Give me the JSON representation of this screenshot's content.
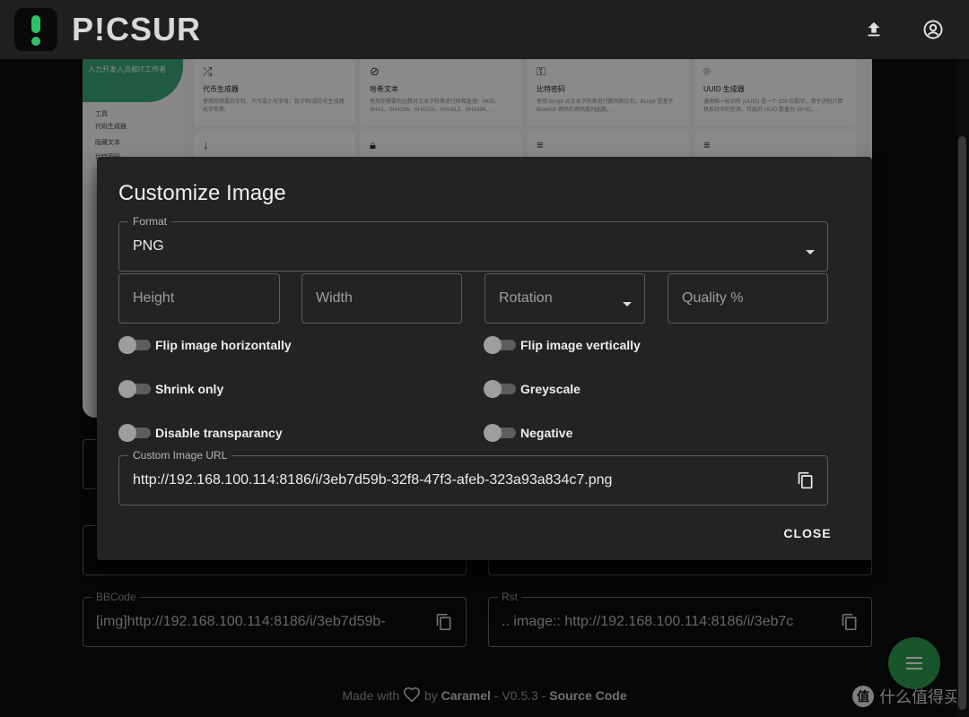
{
  "app": {
    "logo_text": "P!CSUR"
  },
  "background": {
    "preview": {
      "hero_text": "人力开发人员和IT工作者",
      "side_items": [
        "工具",
        "代码生成器",
        "隐藏文本",
        "比特密码"
      ],
      "tiles": [
        {
          "icon": "⤮",
          "title": "代币生成器",
          "desc": "使用你想要的字符、大写或小写字母、数字和/或符号生成随机字符串。"
        },
        {
          "icon": "⊘",
          "title": "哈希文本",
          "desc": "使用你需要的函数对文本字符串进行哈希处理：MD5、SHA1、SHA256、SHA224、SHA512、SHA384、..."
        },
        {
          "icon": "⚿",
          "title": "比特密码",
          "desc": "使用 bcrypt 对文本字符串进行散列和比较。Bcrypt 是基于 Blowfish 密码的密码散列函数。..."
        },
        {
          "icon": "⌾",
          "title": "UUID 生成器",
          "desc": "通用唯一标识符 (UUID) 是一个 128 位数字，用于识别计算机系统中的信息。可能的 UUID 数量为 16^32，..."
        }
      ]
    },
    "fields": {
      "bbcode_label": "BBCode",
      "bbcode_value": "[img]http://192.168.100.114:8186/i/3eb7d59b-",
      "rst_label": "Rst",
      "rst_value": ".. image:: http://192.168.100.114:8186/i/3eb7c"
    },
    "footer": {
      "made_with": "Made with",
      "by": "by",
      "author": "Caramel",
      "version": "- V0.5.3 -",
      "source": "Source Code"
    },
    "watermark": {
      "badge": "值",
      "text": "什么值得买"
    }
  },
  "dialog": {
    "title": "Customize Image",
    "format_label": "Format",
    "format_value": "PNG",
    "height_placeholder": "Height",
    "width_placeholder": "Width",
    "rotation_placeholder": "Rotation",
    "quality_placeholder": "Quality %",
    "toggles": {
      "flip_h": "Flip image horizontally",
      "flip_v": "Flip image vertically",
      "shrink": "Shrink only",
      "greyscale": "Greyscale",
      "transparency": "Disable transparancy",
      "negative": "Negative"
    },
    "url_label": "Custom Image URL",
    "url_value": "http://192.168.100.114:8186/i/3eb7d59b-32f8-47f3-afeb-323a93a834c7.png",
    "close_label": "CLOSE"
  }
}
